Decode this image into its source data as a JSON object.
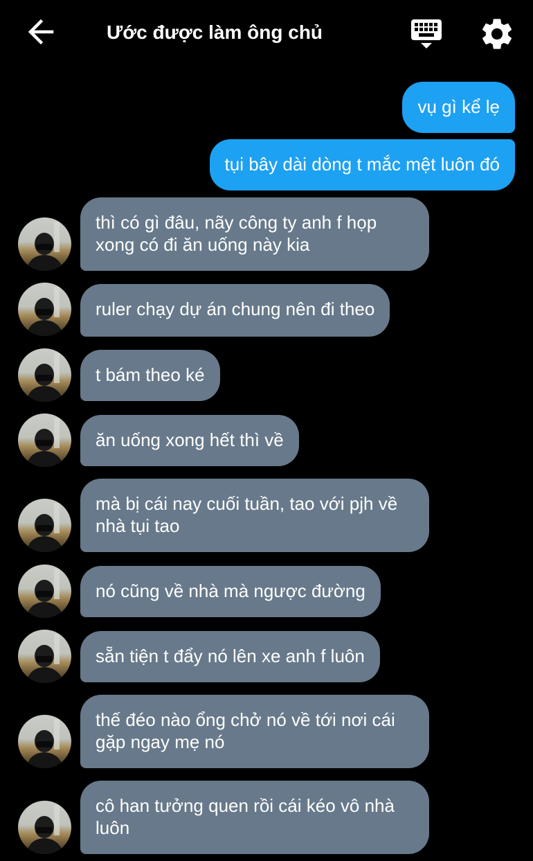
{
  "header": {
    "title": "Ước được làm ông chủ",
    "back_icon": "arrow-left-icon",
    "keyboard_icon": "keyboard-icon",
    "settings_icon": "gear-icon"
  },
  "colors": {
    "background": "#000000",
    "outgoing_bubble": "#1da1f2",
    "incoming_bubble": "#67798a",
    "text": "#ffffff"
  },
  "messages": [
    {
      "direction": "outgoing",
      "lines": [
        "vụ gì kể lẹ"
      ]
    },
    {
      "direction": "outgoing",
      "lines": [
        "tụi bây dài dòng t mắc mệt luôn đó"
      ]
    },
    {
      "direction": "incoming",
      "lines": [
        "thì có gì đâu, nãy công ty anh f họp",
        "xong có đi ăn uống này kia"
      ]
    },
    {
      "direction": "incoming",
      "lines": [
        "ruler chạy dự án chung nên đi theo"
      ]
    },
    {
      "direction": "incoming",
      "lines": [
        "t bám theo ké"
      ]
    },
    {
      "direction": "incoming",
      "lines": [
        "ăn uống xong hết thì về"
      ]
    },
    {
      "direction": "incoming",
      "lines": [
        "mà bị cái nay cuối tuần, tao với pjh về",
        "nhà tụi tao"
      ]
    },
    {
      "direction": "incoming",
      "lines": [
        "nó cũng về nhà mà ngược đường"
      ]
    },
    {
      "direction": "incoming",
      "lines": [
        "sẵn tiện t đẩy nó lên xe anh f luôn"
      ]
    },
    {
      "direction": "incoming",
      "lines": [
        "thế đéo nào ổng chở nó về tới nơi cái",
        "gặp ngay mẹ nó"
      ]
    },
    {
      "direction": "incoming",
      "lines": [
        "cô han tưởng quen rồi cái kéo vô nhà",
        "luôn"
      ]
    }
  ]
}
